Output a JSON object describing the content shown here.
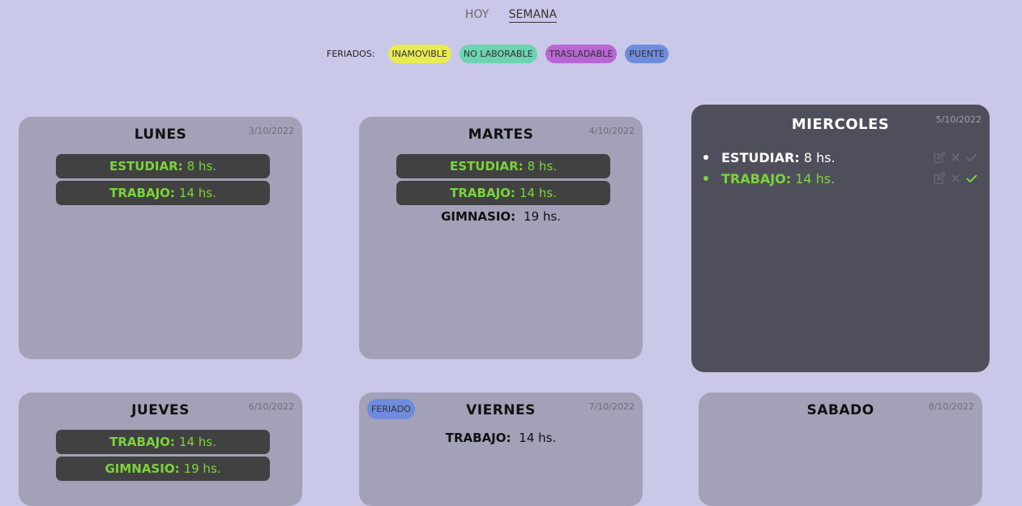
{
  "nav": {
    "hoy": "HOY",
    "semana": "SEMANA"
  },
  "legend": {
    "label": "FERIADOS:",
    "chips": [
      "INAMOVIBLE",
      "NO LABORABLE",
      "TRASLADABLE",
      "PUENTE"
    ]
  },
  "days": [
    {
      "name": "LUNES",
      "date": "3/10/2022",
      "tasks": [
        {
          "label": "ESTUDIAR:",
          "time": "8 hs."
        },
        {
          "label": "TRABAJO:",
          "time": "14 hs."
        }
      ]
    },
    {
      "name": "MARTES",
      "date": "4/10/2022",
      "tasks": [
        {
          "label": "ESTUDIAR:",
          "time": "8 hs."
        },
        {
          "label": "TRABAJO:",
          "time": "14 hs."
        },
        {
          "label": "GIMNASIO:",
          "time": "19 hs."
        }
      ]
    },
    {
      "name": "MIERCOLES",
      "date": "5/10/2022",
      "tasks": [
        {
          "label": "ESTUDIAR:",
          "time": "8 hs."
        },
        {
          "label": "TRABAJO:",
          "time": "14 hs."
        }
      ]
    },
    {
      "name": "JUEVES",
      "date": "6/10/2022",
      "tasks": [
        {
          "label": "TRABAJO:",
          "time": "14 hs."
        },
        {
          "label": "GIMNASIO:",
          "time": "19 hs."
        }
      ]
    },
    {
      "name": "VIERNES",
      "date": "7/10/2022",
      "badge": "FERIADO",
      "tasks": [
        {
          "label": "TRABAJO:",
          "time": "14 hs."
        }
      ]
    },
    {
      "name": "SABADO",
      "date": "8/10/2022",
      "tasks": []
    }
  ],
  "colors": {
    "background": "#cac8e8",
    "card": "#a2a1b7",
    "current_card": "#4f4f5c",
    "done_green": "#7bd43a",
    "inamovible": "#e8ec52",
    "no_laborable": "#6cd4b0",
    "trasladable": "#b866d6",
    "puente": "#6f8cdc"
  }
}
